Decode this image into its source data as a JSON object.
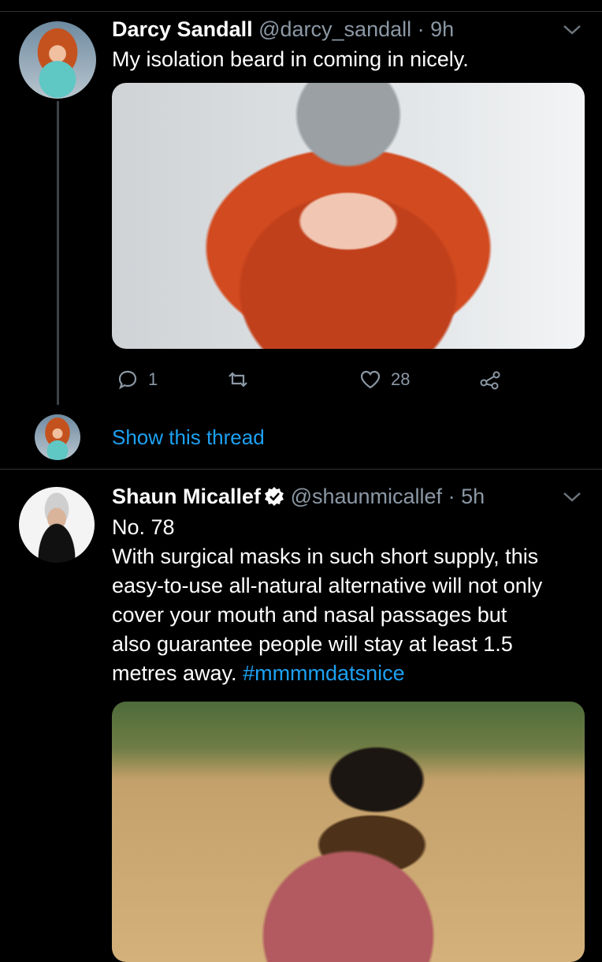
{
  "tweet1": {
    "name": "Darcy Sandall",
    "handle": "@darcy_sandall",
    "separator": "·",
    "time": "9h",
    "text": "My isolation beard in coming in nicely.",
    "reply_count": "1",
    "like_count": "28",
    "show_thread": "Show this thread"
  },
  "tweet2": {
    "name": "Shaun Micallef",
    "handle": "@shaunmicallef",
    "separator": "·",
    "time": "5h",
    "line1": "No. 78",
    "line2": "With surgical masks in such short supply, this",
    "line3": "easy-to-use all-natural alternative will not only",
    "line4": "cover your mouth and nasal passages but",
    "line5": "also guarantee people will stay at least 1.5",
    "line6_prefix": "metres away.",
    "hashtag": "#mmmmdatsnice"
  },
  "colors": {
    "background": "#000000",
    "accent": "#1da1f2",
    "muted": "#8b98a5"
  },
  "icons": [
    "chevron-down-icon",
    "reply-icon",
    "retweet-icon",
    "like-icon",
    "share-icon",
    "verified-badge-icon"
  ]
}
